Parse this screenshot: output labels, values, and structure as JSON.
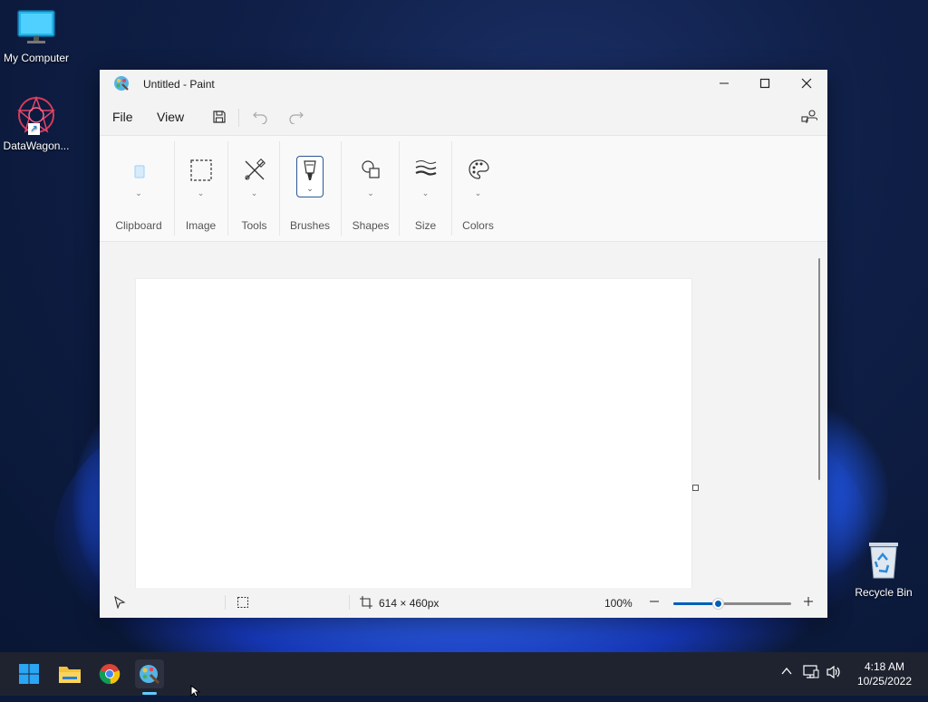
{
  "desktop": {
    "icons": [
      {
        "label": "My Computer"
      },
      {
        "label": "DataWagon..."
      },
      {
        "label": "Recycle Bin"
      }
    ]
  },
  "window": {
    "title": "Untitled - Paint",
    "menu": {
      "file": "File",
      "view": "View"
    },
    "ribbon": {
      "groups": [
        {
          "label": "Clipboard",
          "icon": "clipboard-icon"
        },
        {
          "label": "Image",
          "icon": "select-icon"
        },
        {
          "label": "Tools",
          "icon": "tools-icon"
        },
        {
          "label": "Brushes",
          "icon": "brush-icon"
        },
        {
          "label": "Shapes",
          "icon": "shapes-icon"
        },
        {
          "label": "Size",
          "icon": "size-icon"
        },
        {
          "label": "Colors",
          "icon": "palette-icon"
        }
      ]
    },
    "status": {
      "canvas_size": "614 × 460px",
      "zoom": "100%",
      "zoom_fraction": 0.38
    },
    "accent_color": "#005fb8"
  },
  "taskbar": {
    "apps": [
      "start-icon",
      "file-explorer-icon",
      "chrome-icon",
      "paint-icon"
    ],
    "clock": {
      "time": "4:18 AM",
      "date": "10/25/2022"
    }
  }
}
